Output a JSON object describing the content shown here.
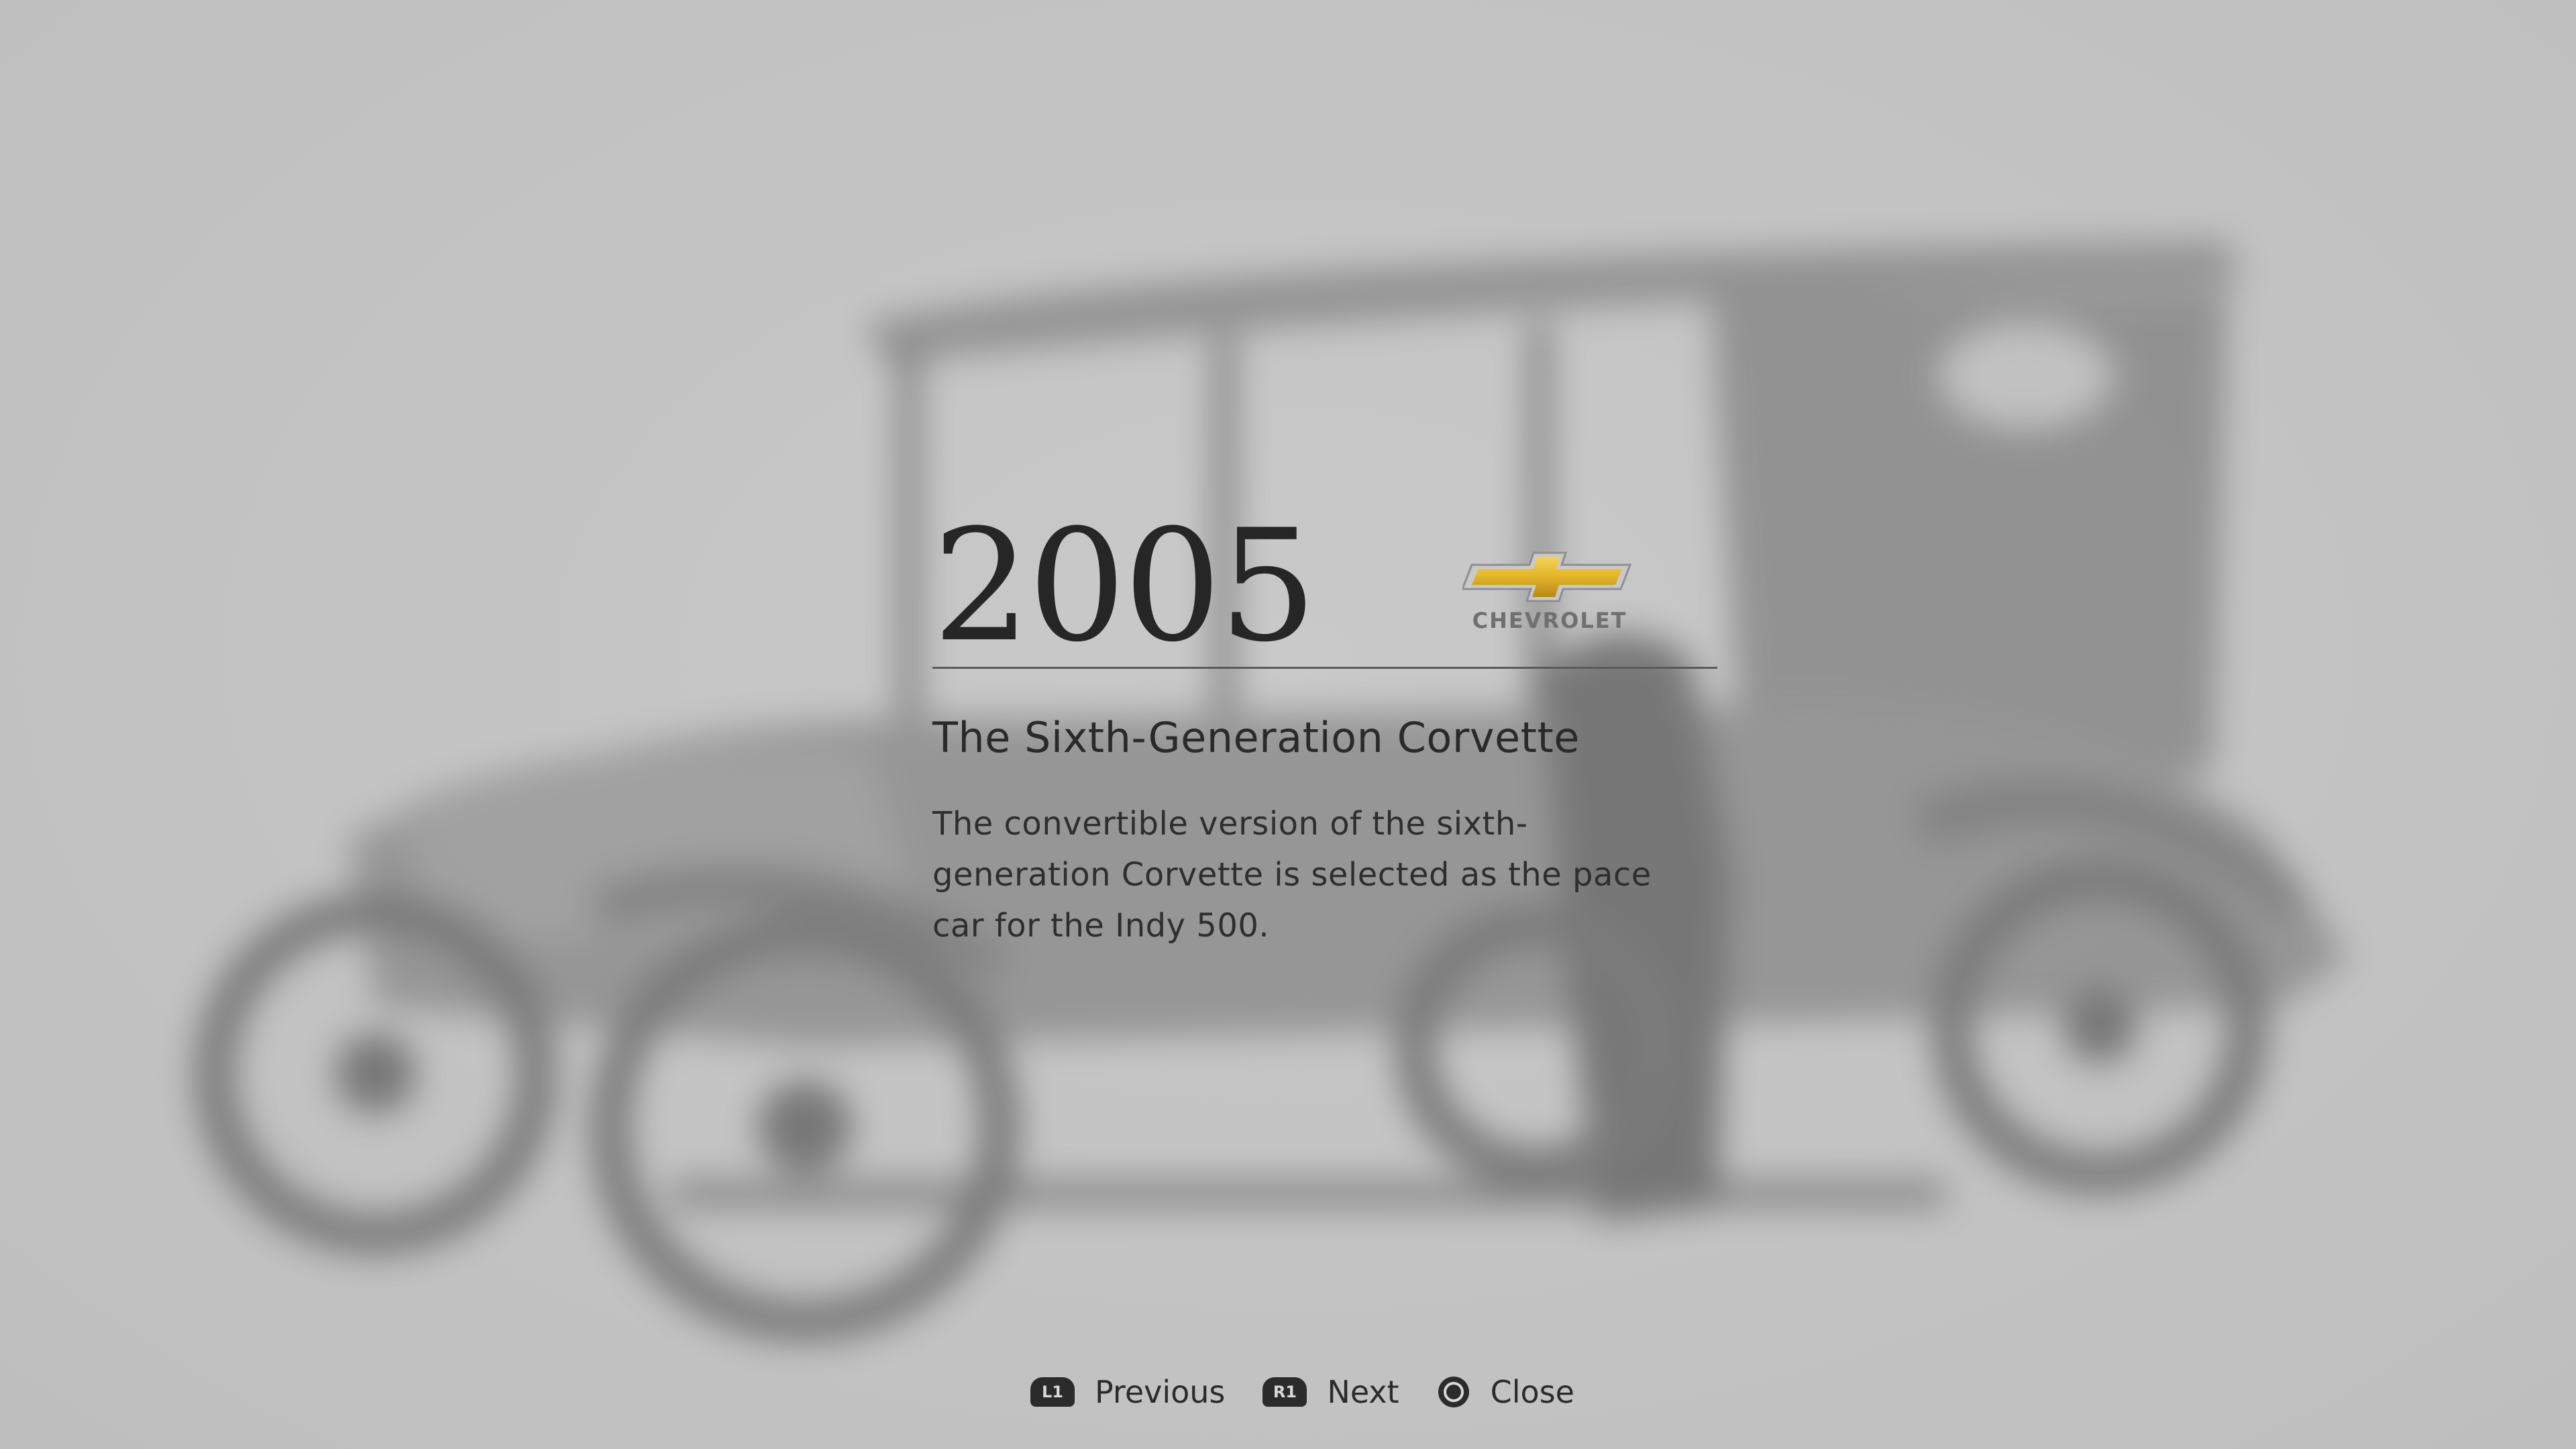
{
  "entry": {
    "year": "2005",
    "brand": "CHEVROLET",
    "title": "The Sixth-Generation Corvette",
    "description": "The convertible version of the sixth-generation Corvette is selected as the pace car for the Indy 500."
  },
  "prompts": {
    "previous": {
      "button": "L1",
      "label": "Previous"
    },
    "next": {
      "button": "R1",
      "label": "Next"
    },
    "close": {
      "button": "circle-icon",
      "label": "Close"
    }
  },
  "background": {
    "image": "blurred-vintage-car-photo",
    "tone": "#c4c4c4"
  },
  "colors": {
    "brand_gold": "#e3b52a",
    "text": "#2a2a2a"
  }
}
